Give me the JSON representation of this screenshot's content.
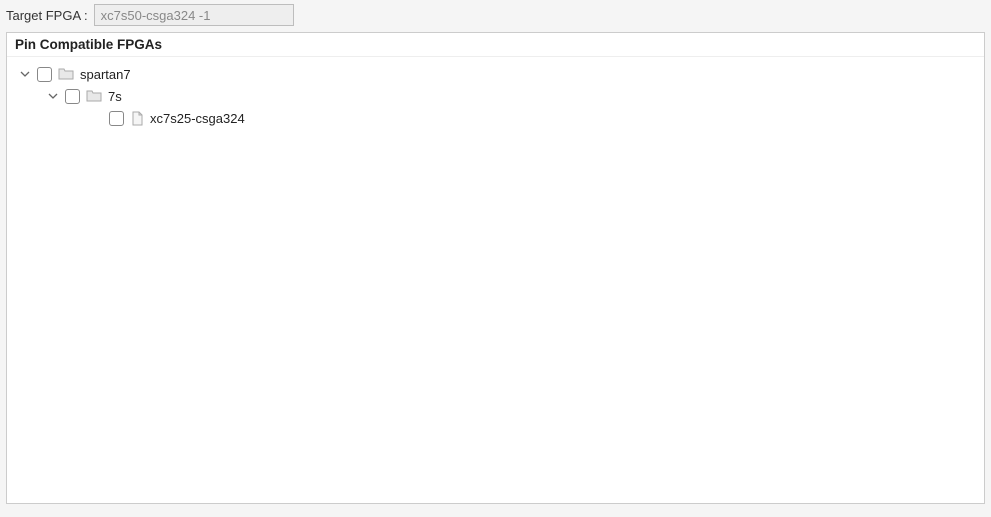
{
  "targetField": {
    "label": "Target FPGA :",
    "value": "xc7s50-csga324 -1"
  },
  "panel": {
    "title": "Pin Compatible FPGAs"
  },
  "tree": {
    "nodes": [
      {
        "label": "spartan7",
        "expanded": true,
        "checked": false,
        "type": "folder",
        "indent": 0
      },
      {
        "label": "7s",
        "expanded": true,
        "checked": false,
        "type": "folder",
        "indent": 1
      },
      {
        "label": "xc7s25-csga324",
        "expanded": false,
        "checked": false,
        "type": "file",
        "indent": 2
      }
    ]
  }
}
